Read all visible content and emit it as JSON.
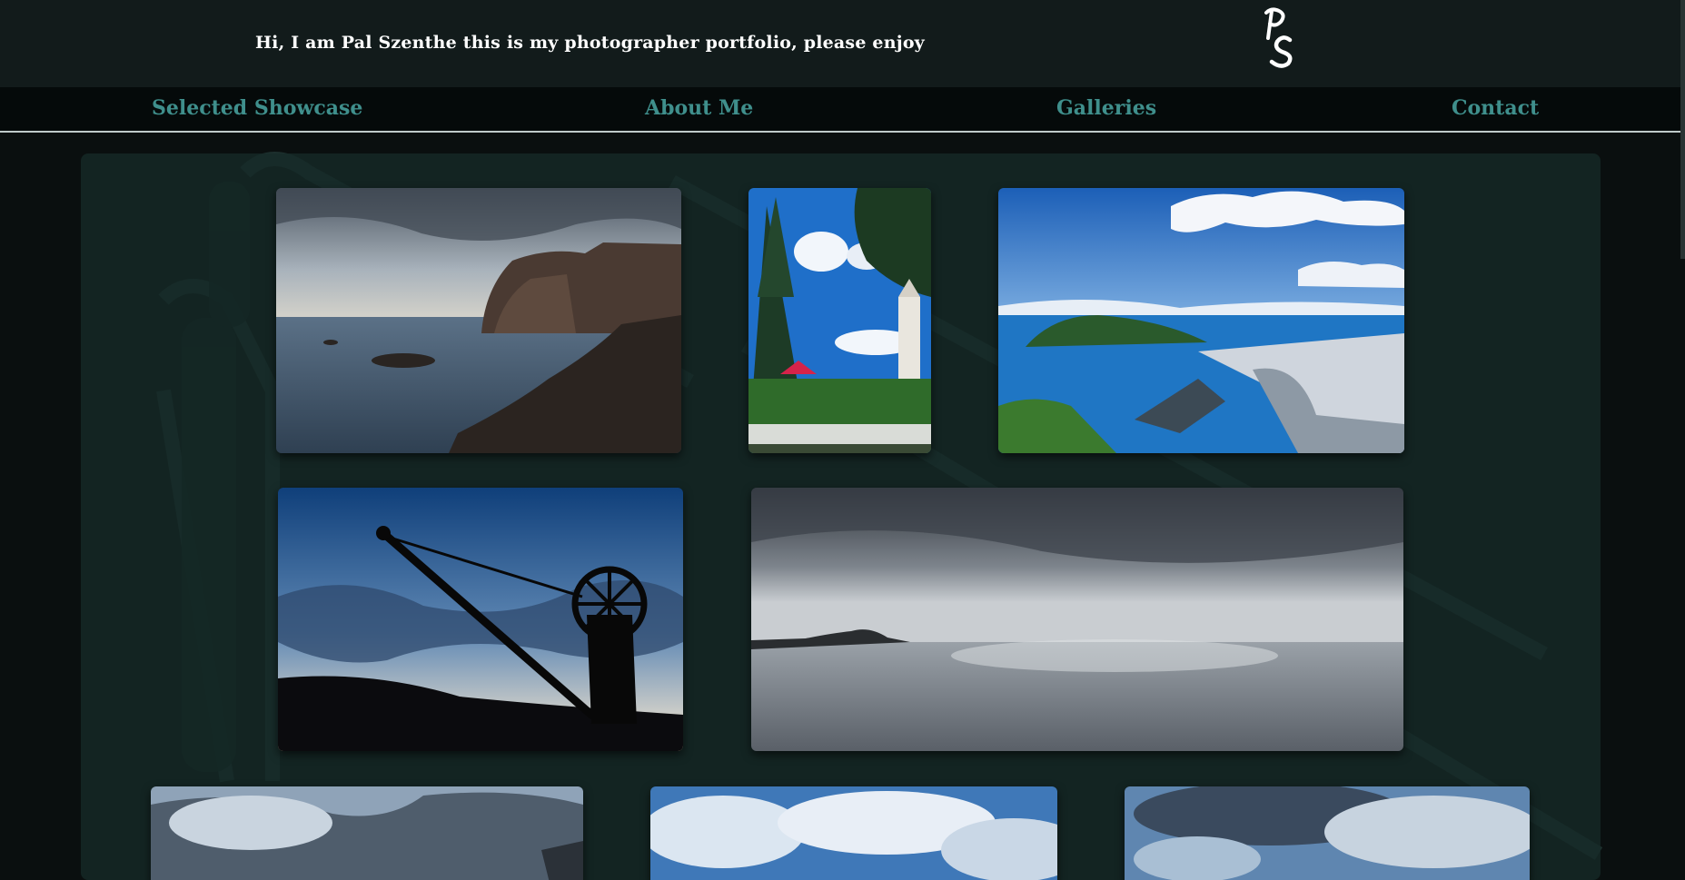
{
  "header": {
    "greeting": "Hi, I am Pal Szenthe this is my photographer portfolio, please enjoy",
    "logo_text": "PS"
  },
  "nav": {
    "items": [
      {
        "label": "Selected Showcase"
      },
      {
        "label": "About Me"
      },
      {
        "label": "Galleries"
      },
      {
        "label": "Contact"
      }
    ]
  },
  "colors": {
    "header_bg": "#121b1b",
    "nav_bg": "#050a0a",
    "nav_text": "#3f8f8c",
    "panel_bg": "#162a28",
    "page_bg": "#0a0f0f"
  },
  "gallery": {
    "photos": [
      {
        "subject": "rocky coastal cliffs under cloudy sky"
      },
      {
        "subject": "pine tree and church tower with red roof"
      },
      {
        "subject": "aerial view of harbor town and island"
      },
      {
        "subject": "silhouette of old crane against blue sky"
      },
      {
        "subject": "grey sea with distant island under stormy sky"
      },
      {
        "subject": "cloudy sky over hillside"
      },
      {
        "subject": "cumulus clouds in blue sky"
      },
      {
        "subject": "dramatic storm clouds"
      }
    ]
  }
}
